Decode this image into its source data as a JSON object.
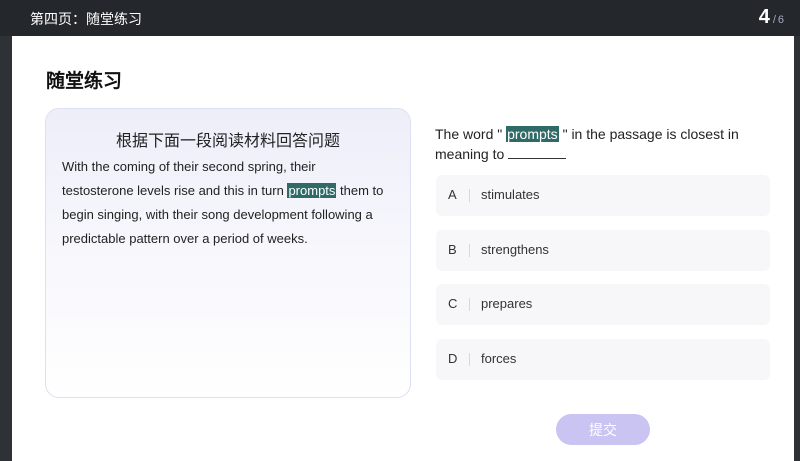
{
  "topbar": {
    "title": "第四页：随堂练习",
    "page_current": "4",
    "page_separator": "/",
    "page_total": "6"
  },
  "section_title": "随堂练习",
  "passage": {
    "heading": "根据下面一段阅读材料回答问题",
    "text_before": "With the coming of their second spring, their testosterone levels rise and this in turn ",
    "highlight": "prompts",
    "text_after": " them to begin singing, with their song development following a predictable pattern over a period of weeks."
  },
  "question": {
    "prefix": "The word \"",
    "highlight": "prompts",
    "suffix": "\" in the passage is closest in meaning to"
  },
  "options": [
    {
      "letter": "A",
      "text": "stimulates"
    },
    {
      "letter": "B",
      "text": "strengthens"
    },
    {
      "letter": "C",
      "text": "prepares"
    },
    {
      "letter": "D",
      "text": "forces"
    }
  ],
  "submit_label": "提交",
  "colors": {
    "topbar": "#24282c",
    "highlight": "#2f6a67",
    "submit_button": "#c9c4f2",
    "option_bg": "#f7f7f9"
  }
}
